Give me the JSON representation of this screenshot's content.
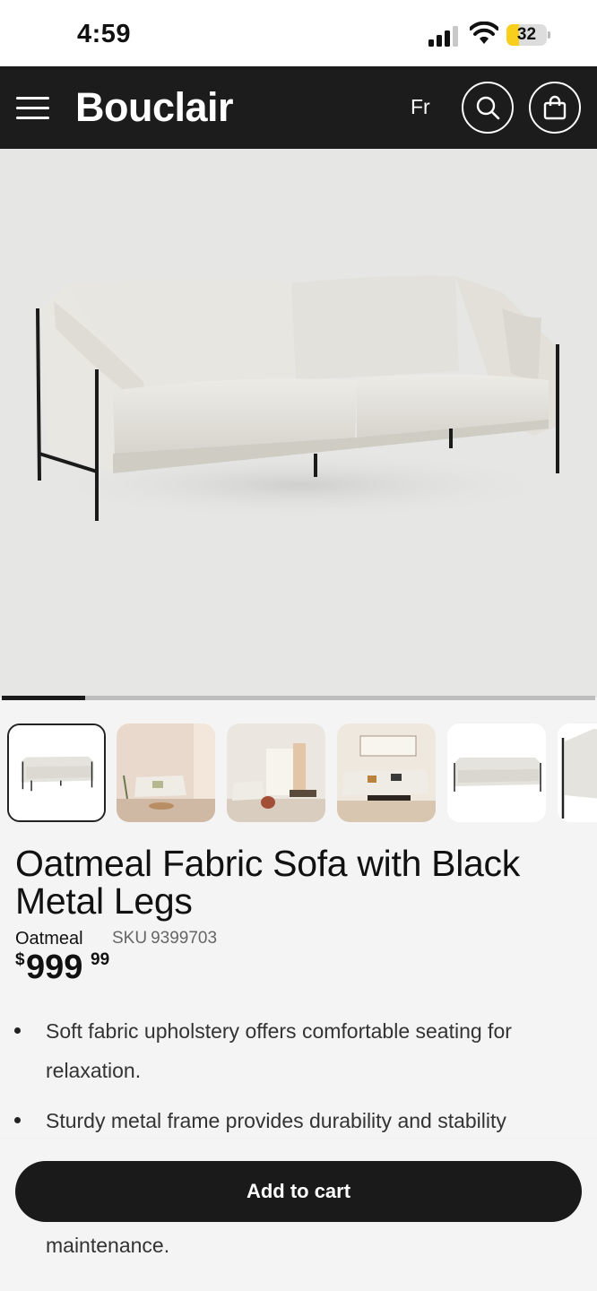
{
  "status_bar": {
    "time": "4:59",
    "battery_level": 32,
    "battery_text": "32",
    "icons": [
      "signal-icon",
      "wifi-icon",
      "battery-icon"
    ]
  },
  "header": {
    "logo": "Bouclair",
    "language_link": "Fr",
    "icons": [
      "hamburger-menu-icon",
      "search-icon",
      "shopping-bag-icon"
    ],
    "background_color": "#1c1c1c"
  },
  "gallery": {
    "carousel_position": 0.14,
    "thumbnails": [
      {
        "name": "sofa-front-view",
        "selected": true
      },
      {
        "name": "living-room-scene-1",
        "selected": false
      },
      {
        "name": "living-room-scene-2",
        "selected": false
      },
      {
        "name": "living-room-scene-3",
        "selected": false
      },
      {
        "name": "sofa-side-view",
        "selected": false
      },
      {
        "name": "sofa-detail-view",
        "selected": false
      }
    ]
  },
  "product": {
    "title": "Oatmeal Fabric Sofa with Black Metal Legs",
    "variant": "Oatmeal",
    "sku_label": "SKU",
    "sku_number": "9399703",
    "price": {
      "currency_symbol": "$",
      "dollars": "999",
      "cents": "99"
    },
    "features": [
      "Soft fabric upholstery offers comfortable seating for relaxation.",
      "Sturdy metal frame provides durability and stability"
    ],
    "partial_feature_text": "maintenance."
  },
  "cart": {
    "add_to_cart_label": "Add to cart",
    "button_color": "#1a1a1a"
  }
}
